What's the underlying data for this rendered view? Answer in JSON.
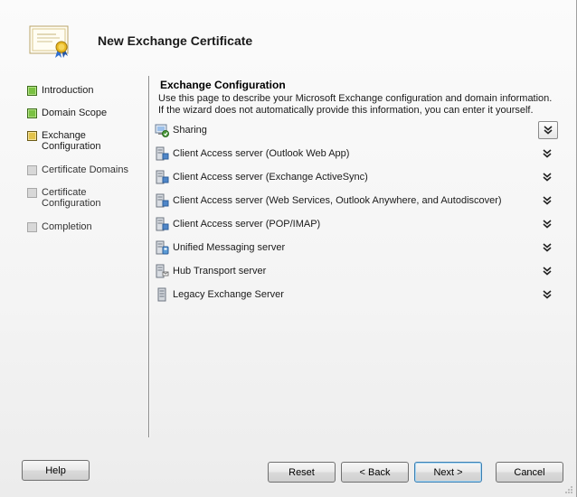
{
  "wizard": {
    "title": "New Exchange Certificate"
  },
  "nav": {
    "items": [
      {
        "label": "Introduction",
        "state": "done"
      },
      {
        "label": "Domain Scope",
        "state": "done"
      },
      {
        "label": "Exchange Configuration",
        "state": "current"
      },
      {
        "label": "Certificate Domains",
        "state": "pending"
      },
      {
        "label": "Certificate Configuration",
        "state": "pending"
      },
      {
        "label": "Completion",
        "state": "pending"
      }
    ]
  },
  "content": {
    "title": "Exchange Configuration",
    "description": "Use this page to describe your Microsoft Exchange configuration and domain information. If the wizard does not automatically provide this information, you can enter it yourself.",
    "sections": [
      {
        "label": "Sharing",
        "icon": "sharing-icon"
      },
      {
        "label": "Client Access server (Outlook Web App)",
        "icon": "server-icon"
      },
      {
        "label": "Client Access server (Exchange ActiveSync)",
        "icon": "server-icon"
      },
      {
        "label": "Client Access server (Web Services, Outlook Anywhere, and Autodiscover)",
        "icon": "server-icon"
      },
      {
        "label": "Client Access server (POP/IMAP)",
        "icon": "server-icon"
      },
      {
        "label": "Unified Messaging server",
        "icon": "um-server-icon"
      },
      {
        "label": "Hub Transport server",
        "icon": "transport-server-icon"
      },
      {
        "label": "Legacy Exchange Server",
        "icon": "legacy-server-icon"
      }
    ]
  },
  "buttons": {
    "help": "Help",
    "reset": "Reset",
    "back": "< Back",
    "next": "Next >",
    "cancel": "Cancel"
  },
  "colors": {
    "done": "#7ac142",
    "current": "#e3c34a",
    "pending": "#d8d8d8"
  }
}
